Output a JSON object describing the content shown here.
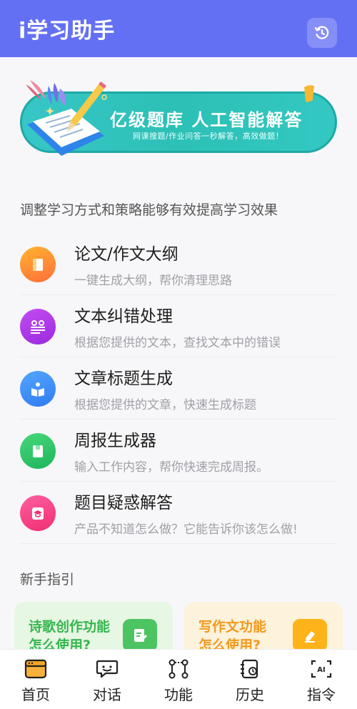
{
  "header": {
    "title": "i学习助手",
    "history_icon": "history-clock-icon"
  },
  "banner": {
    "headline": "亿级题库  人工智能解答",
    "subtitle": "网课搜题/作业问答一秒解答，高效做题！"
  },
  "section_tip": "调整学习方式和策略能够有效提高学习效果",
  "features": [
    {
      "name": "论文/作文大纲",
      "desc": "一键生成大纲，帮你清理思路",
      "icon": "book-icon"
    },
    {
      "name": "文本纠错处理",
      "desc": "根据您提供的文本，查找文本中的错误",
      "icon": "text-check-icon"
    },
    {
      "name": "文章标题生成",
      "desc": "根据您提供的文章，快速生成标题",
      "icon": "reader-icon"
    },
    {
      "name": "周报生成器",
      "desc": "输入工作内容，帮你快速完成周报。",
      "icon": "report-icon"
    },
    {
      "name": "题目疑惑解答",
      "desc": "产品不知道怎么做？它能告诉你该怎么做!",
      "icon": "graduation-cap-icon"
    }
  ],
  "guide": {
    "title": "新手指引",
    "cards": [
      {
        "text_line1": "诗歌创作功能",
        "text_line2": "怎么使用?",
        "icon": "edit-note-icon",
        "color": "#4cc462"
      },
      {
        "text_line1": "写作文功能",
        "text_line2": "怎么使用?",
        "icon": "eraser-icon",
        "color": "#ffb31a"
      }
    ]
  },
  "tabbar": [
    {
      "label": "首页",
      "icon": "home-browser-icon",
      "active": true
    },
    {
      "label": "对话",
      "icon": "chat-bubble-icon",
      "active": false
    },
    {
      "label": "功能",
      "icon": "nodes-icon",
      "active": false
    },
    {
      "label": "历史",
      "icon": "history-notebook-icon",
      "active": false
    },
    {
      "label": "指令",
      "icon": "ai-scan-icon",
      "active": false
    }
  ],
  "colors": {
    "header_bg": "#6470f4",
    "banner_bg": "#2cc0b6",
    "active_tab": "#f5a623"
  }
}
